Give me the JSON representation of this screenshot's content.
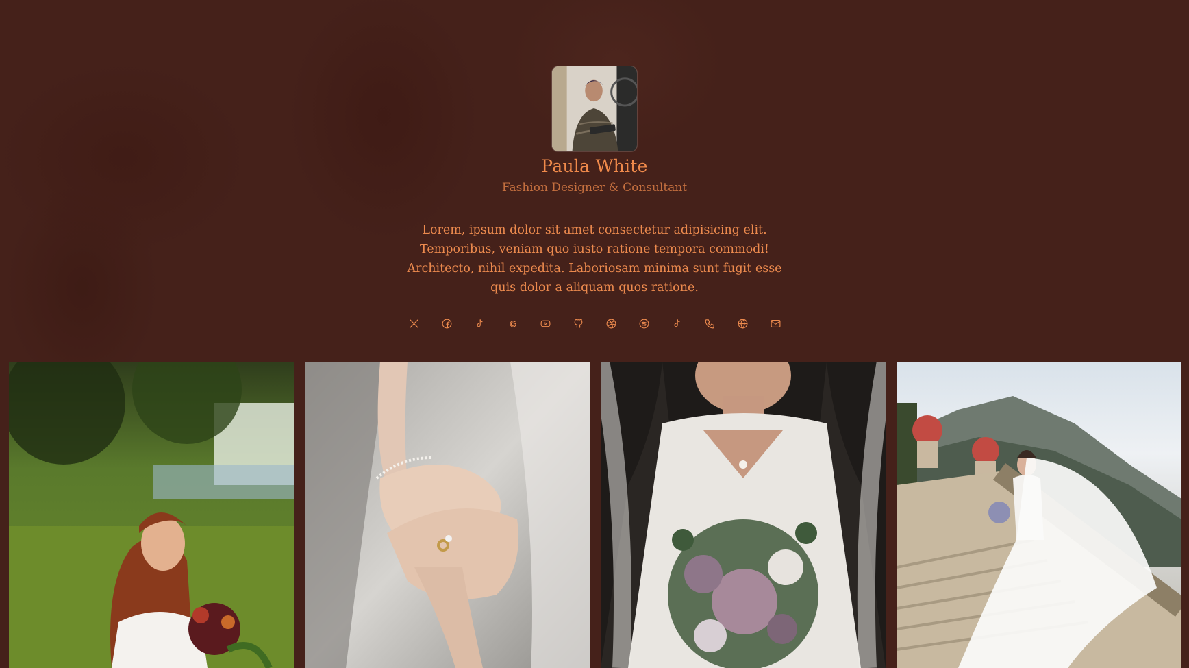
{
  "profile": {
    "name": "Paula White",
    "subtitle": "Fashion Designer & Consultant",
    "bio": "Lorem, ipsum dolor sit amet consectetur adipisicing elit. Temporibus, veniam quo iusto ratione tempora commodi! Architecto, nihil expedita. Laboriosam minima sunt fugit esse quis dolor a aliquam quos ratione."
  },
  "socials": [
    {
      "icon": "x-icon"
    },
    {
      "icon": "facebook-icon"
    },
    {
      "icon": "tiktok-icon"
    },
    {
      "icon": "threads-icon"
    },
    {
      "icon": "youtube-icon"
    },
    {
      "icon": "github-icon"
    },
    {
      "icon": "dribbble-icon"
    },
    {
      "icon": "spotify-icon"
    },
    {
      "icon": "tiktok-icon"
    },
    {
      "icon": "phone-icon"
    },
    {
      "icon": "globe-icon"
    },
    {
      "icon": "mail-icon"
    }
  ],
  "gallery": [
    {
      "subject": "bride-with-bouquet-in-forest"
    },
    {
      "subject": "hands-with-ring"
    },
    {
      "subject": "bride-with-flower-bouquet"
    },
    {
      "subject": "bride-on-stone-staircase"
    }
  ],
  "colors": {
    "background": "#45211a",
    "accent": "#f08a4b",
    "muted": "#c46f3f"
  }
}
